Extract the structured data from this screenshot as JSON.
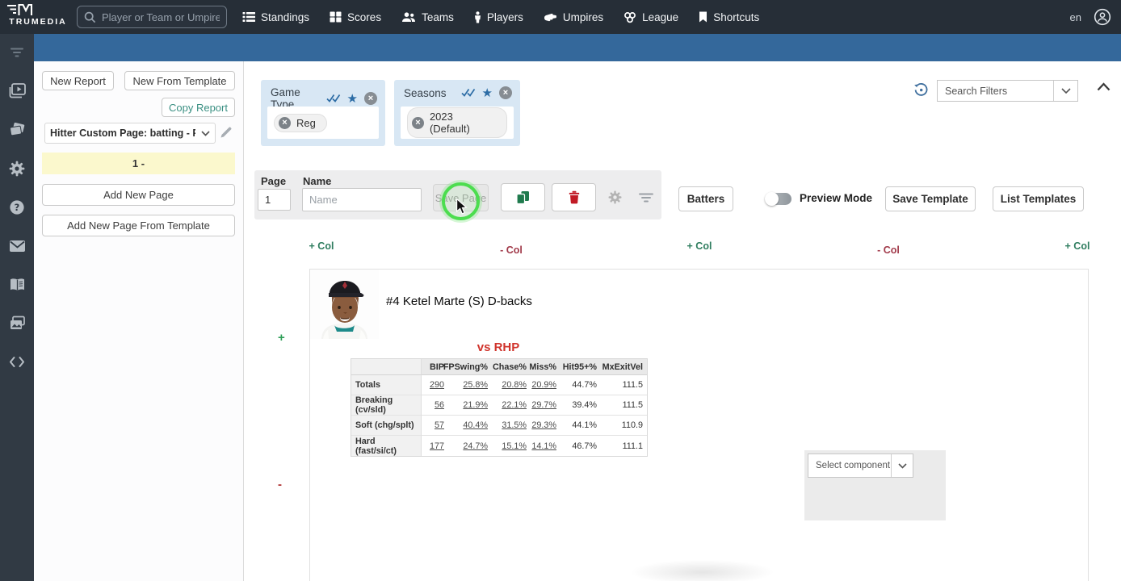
{
  "navbar": {
    "brand": "TRUMEDIA",
    "search_placeholder": "Player or Team or Umpire",
    "items": [
      {
        "label": "Standings",
        "icon": "list-icon"
      },
      {
        "label": "Scores",
        "icon": "grid-icon"
      },
      {
        "label": "Teams",
        "icon": "users-icon"
      },
      {
        "label": "Players",
        "icon": "person-icon"
      },
      {
        "label": "Umpires",
        "icon": "hand-icon"
      },
      {
        "label": "League",
        "icon": "rings-icon"
      },
      {
        "label": "Shortcuts",
        "icon": "bookmark-icon"
      }
    ],
    "language": "en"
  },
  "sidebar": {
    "icons": [
      "filter-lines",
      "video-library",
      "flashcards",
      "settings",
      "help",
      "mail",
      "glossary",
      "image-stack",
      "code"
    ]
  },
  "report_panel": {
    "new_report": "New Report",
    "new_from_template": "New From Template",
    "copy_report": "Copy Report",
    "report_select_value": "Hitter Custom Page: batting - P...",
    "page_list_item": "1 -",
    "add_new_page": "Add New Page",
    "add_new_page_from_template": "Add New Page From Template"
  },
  "filter_bar": {
    "cards": [
      {
        "title": "Game Type",
        "chip": "Reg"
      },
      {
        "title": "Seasons",
        "chip": "2023 (Default)"
      }
    ],
    "search_filters": "Search Filters"
  },
  "page_form": {
    "page_label": "Page",
    "page_value": "1",
    "name_label": "Name",
    "name_placeholder": "Name",
    "save_page": "Save Page"
  },
  "toolbar": {
    "batters": "Batters",
    "preview_mode": "Preview Mode",
    "save_template": "Save Template",
    "list_templates": "List Templates"
  },
  "col_controls": {
    "labels": [
      "+ Col",
      "- Col",
      "+ Col",
      "- Col",
      "+ Col"
    ]
  },
  "row_controls": {
    "add": "+",
    "remove": "-"
  },
  "content": {
    "player_name": "#4 Ketel Marte (S) D-backs",
    "table": {
      "title": "vs RHP",
      "columns": [
        "BIP",
        "FPSwing%",
        "Chase%",
        "Miss%",
        "Hit95+%",
        "MxExitVel"
      ],
      "rows": [
        {
          "label": "Totals",
          "values": [
            "290",
            "25.8%",
            "20.8%",
            "20.9%",
            "44.7%",
            "111.5"
          ]
        },
        {
          "label": "Breaking (cv/sld)",
          "values": [
            "56",
            "21.9%",
            "22.1%",
            "29.7%",
            "39.4%",
            "111.5"
          ]
        },
        {
          "label": "Soft (chg/splt)",
          "values": [
            "57",
            "40.4%",
            "31.5%",
            "29.3%",
            "44.1%",
            "110.9"
          ]
        },
        {
          "label": "Hard (fast/si/ct)",
          "values": [
            "177",
            "24.7%",
            "15.1%",
            "14.1%",
            "46.7%",
            "111.1"
          ]
        }
      ]
    },
    "component_picker": "Select component"
  },
  "icons": {
    "star": "★",
    "close": "×"
  },
  "colors": {
    "navbar_bg": "#262e37",
    "sidebar_bg": "#313a44",
    "accent_bar": "#34689b",
    "filter_card_bg": "#d8e7f4",
    "highlight_yellow": "#fbf8cd",
    "add_green": "#2f7d5f",
    "remove_red": "#a13a4a",
    "title_red": "#d0342c",
    "copy_icon_green": "#1f7a4d",
    "trash_icon_red": "#c11a25",
    "click_ring_green": "#4cdd4f"
  }
}
